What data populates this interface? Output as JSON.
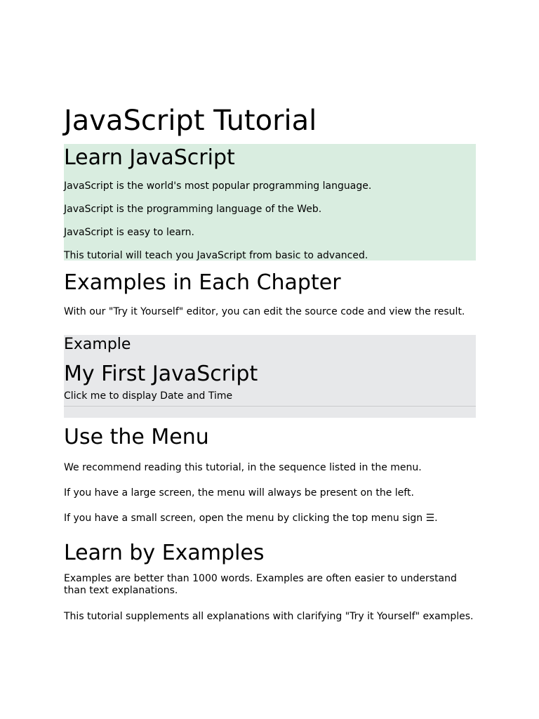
{
  "title": "JavaScript Tutorial",
  "intro": {
    "heading": "Learn JavaScript",
    "paragraphs": [
      "JavaScript is the world's most popular programming language.",
      "JavaScript is the programming language of the Web.",
      "JavaScript is easy to learn.",
      "This tutorial will teach you JavaScript from basic to advanced."
    ]
  },
  "examples_section": {
    "heading": "Examples in Each Chapter",
    "description": "With our \"Try it Yourself\" editor, you can edit the source code and view the result."
  },
  "example_box": {
    "label": "Example",
    "heading": "My First JavaScript",
    "button_label": "Click me to display Date and Time"
  },
  "menu_section": {
    "heading": "Use the Menu",
    "paragraphs": [
      "We recommend reading this tutorial, in the sequence listed in the menu.",
      "If you have a large screen, the menu will always be present on the left.",
      "If you have a small screen, open the menu by clicking the top menu sign ☰."
    ]
  },
  "learn_section": {
    "heading": "Learn by Examples",
    "paragraphs": [
      "Examples are better than 1000 words. Examples are often easier to understand than text explanations.",
      "This tutorial supplements all explanations with clarifying \"Try it Yourself\" examples."
    ]
  },
  "colors": {
    "intro_background": "#d9ede0",
    "example_background": "#e7e8ea"
  }
}
